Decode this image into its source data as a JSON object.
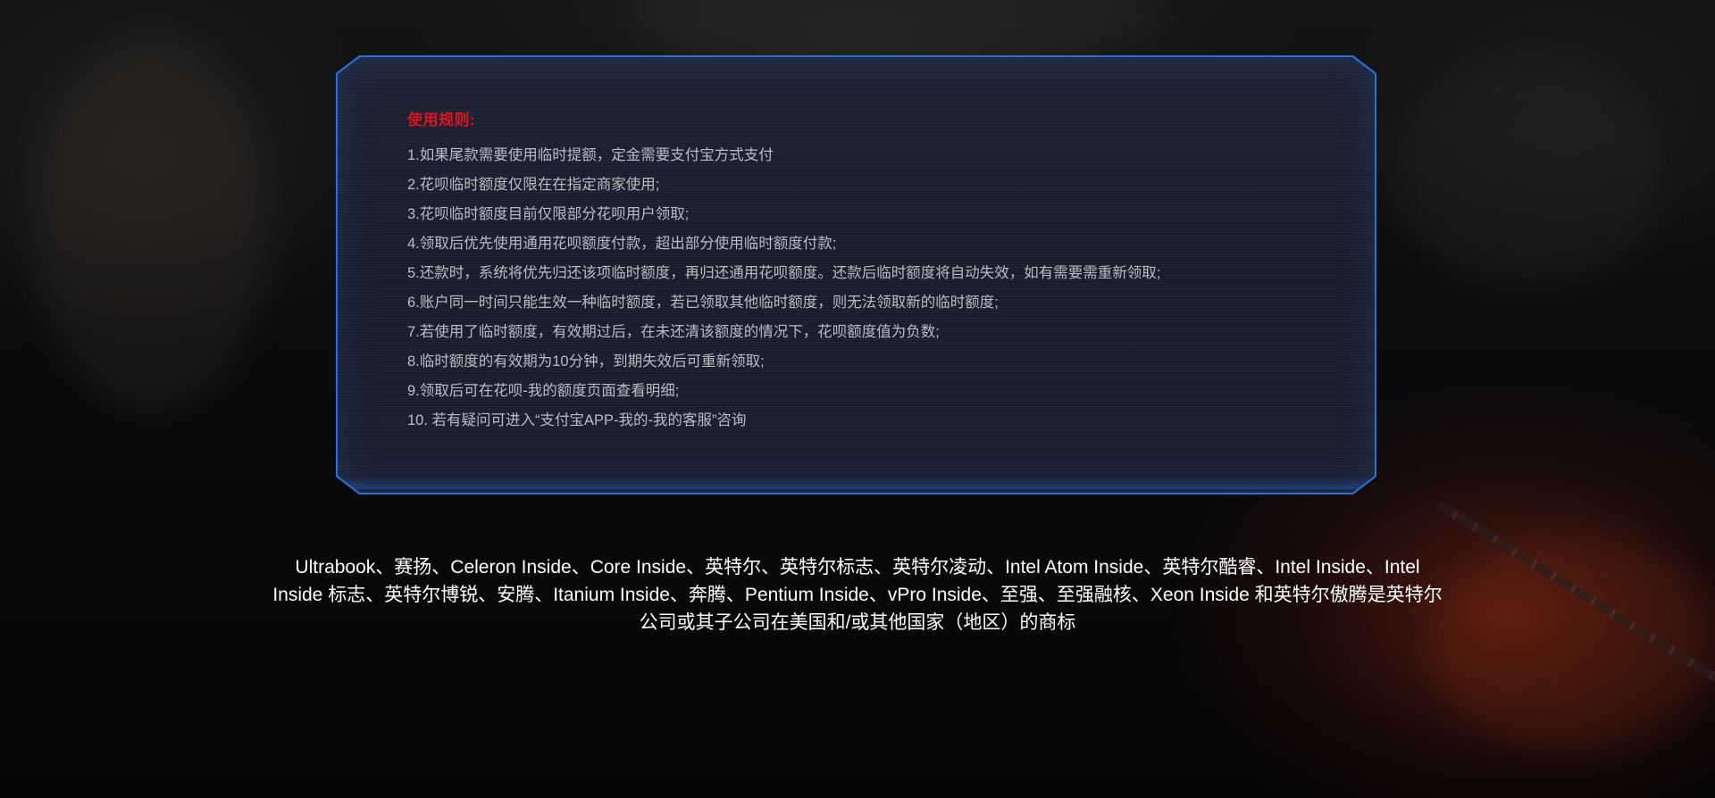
{
  "rules": {
    "title": "使用规则:",
    "items": [
      "1.如果尾款需要使用临时提额，定金需要支付宝方式支付",
      "2.花呗临时额度仅限在在指定商家使用;",
      "3.花呗临时额度目前仅限部分花呗用户领取;",
      "4.领取后优先使用通用花呗额度付款，超出部分使用临时额度付款;",
      "5.还款时，系统将优先归还该项临时额度，再归还通用花呗额度。还款后临时额度将自动失效，如有需要需重新领取;",
      "6.账户同一时间只能生效一种临时额度，若已领取其他临时额度，则无法领取新的临时额度;",
      "7.若使用了临时额度，有效期过后，在未还清该额度的情况下，花呗额度值为负数;",
      "8.临时额度的有效期为10分钟，到期失效后可重新领取;",
      "9.领取后可在花呗-我的额度页面查看明细;",
      "10. 若有疑问可进入“支付宝APP-我的-我的客服”咨询"
    ]
  },
  "footer": {
    "trademark_text": "Ultrabook、赛扬、Celeron Inside、Core Inside、英特尔、英特尔标志、英特尔凌动、Intel Atom Inside、英特尔酷睿、Intel Inside、Intel Inside 标志、英特尔博锐、安腾、Itanium Inside、奔腾、Pentium Inside、vPro Inside、至强、至强融核、Xeon Inside 和英特尔傲腾是英特尔公司或其子公司在美国和/或其他国家（地区）的商标"
  },
  "colors": {
    "title_red": "#e0141e",
    "panel_border_blue": "#2b6fd6",
    "panel_background": "#1d2132",
    "rule_text": "#b9bcc6",
    "footer_text": "#ffffff"
  }
}
